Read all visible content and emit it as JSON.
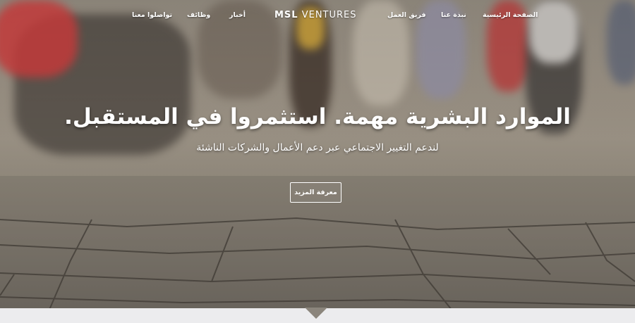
{
  "brand": {
    "strong": "MSL",
    "rest": " VENTURES"
  },
  "nav": {
    "home": "الصفحة الرئيسية",
    "about": "نبذة عنا",
    "team": "فريق العمل",
    "news": "أخبار",
    "jobs": "وظائف",
    "contact": "تواصلوا معنا"
  },
  "hero": {
    "headline": "الموارد البشرية مهمة. استثمروا في المستقبل.",
    "subline": "لندعم التغيير الاجتماعي عبر دعم الأعمال والشركات الناشئة",
    "cta_label": "معرفة المزيد"
  },
  "colors": {
    "text": "#ffffff",
    "footer": "#ececee",
    "arrow": "#8b857c"
  },
  "icons": {
    "scroll_indicator": "chevron-down-icon"
  }
}
